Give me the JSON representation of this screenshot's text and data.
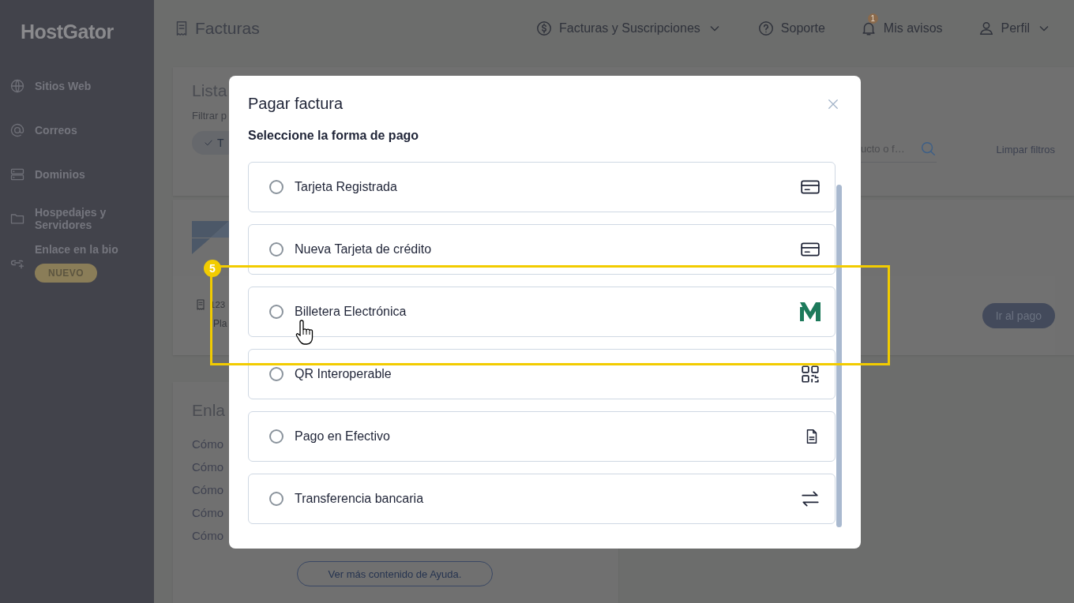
{
  "sidebar": {
    "logo": "HostGator",
    "items": [
      {
        "label": "Sitios Web",
        "kind": "globe"
      },
      {
        "label": "Correos",
        "kind": "at"
      },
      {
        "label": "Dominios",
        "kind": "server"
      },
      {
        "label": "Hospedajes y Servidores",
        "kind": "folder"
      },
      {
        "label": "Enlace en la bio",
        "kind": "link",
        "badge": "NUEVO"
      }
    ]
  },
  "header": {
    "title": "Facturas",
    "nav": [
      {
        "label": "Facturas y Suscripciones",
        "kind": "dollar",
        "dropdown": true
      },
      {
        "label": "Soporte",
        "kind": "help",
        "dropdown": false
      },
      {
        "label": "Mis avisos",
        "kind": "bell",
        "dropdown": false,
        "count": "1"
      },
      {
        "label": "Perfil",
        "kind": "user",
        "dropdown": true
      }
    ]
  },
  "invoice_list": {
    "title": "Lista",
    "filter_label": "Filtrar p",
    "chip": "T",
    "search_placeholder": "ucto o f…",
    "clear_filters": "Limpar filtros"
  },
  "invoice": {
    "number": "123",
    "plan": "Pla",
    "pay_button": "Ir al pago"
  },
  "help": {
    "title": "Enla",
    "links": [
      "Cómo",
      "Cómo",
      "Cómo",
      "Cómo",
      "Cómo"
    ],
    "more_button": "Ver más contenido de Ayuda."
  },
  "dialog": {
    "title": "Pagar factura",
    "subtitle": "Seleccione la forma de pago",
    "options": [
      {
        "label": "Tarjeta Registrada",
        "kind": "card",
        "selected": false
      },
      {
        "label": "Nueva Tarjeta de crédito",
        "kind": "card",
        "selected": false
      },
      {
        "label": "Billetera Electrónica",
        "kind": "wallet",
        "selected": false
      },
      {
        "label": "QR Interoperable",
        "kind": "qr",
        "selected": false
      },
      {
        "label": "Pago en Efectivo",
        "kind": "document",
        "selected": false
      },
      {
        "label": "Transferencia bancaria",
        "kind": "transfer",
        "selected": false
      }
    ]
  },
  "annotation": {
    "step": "5"
  }
}
